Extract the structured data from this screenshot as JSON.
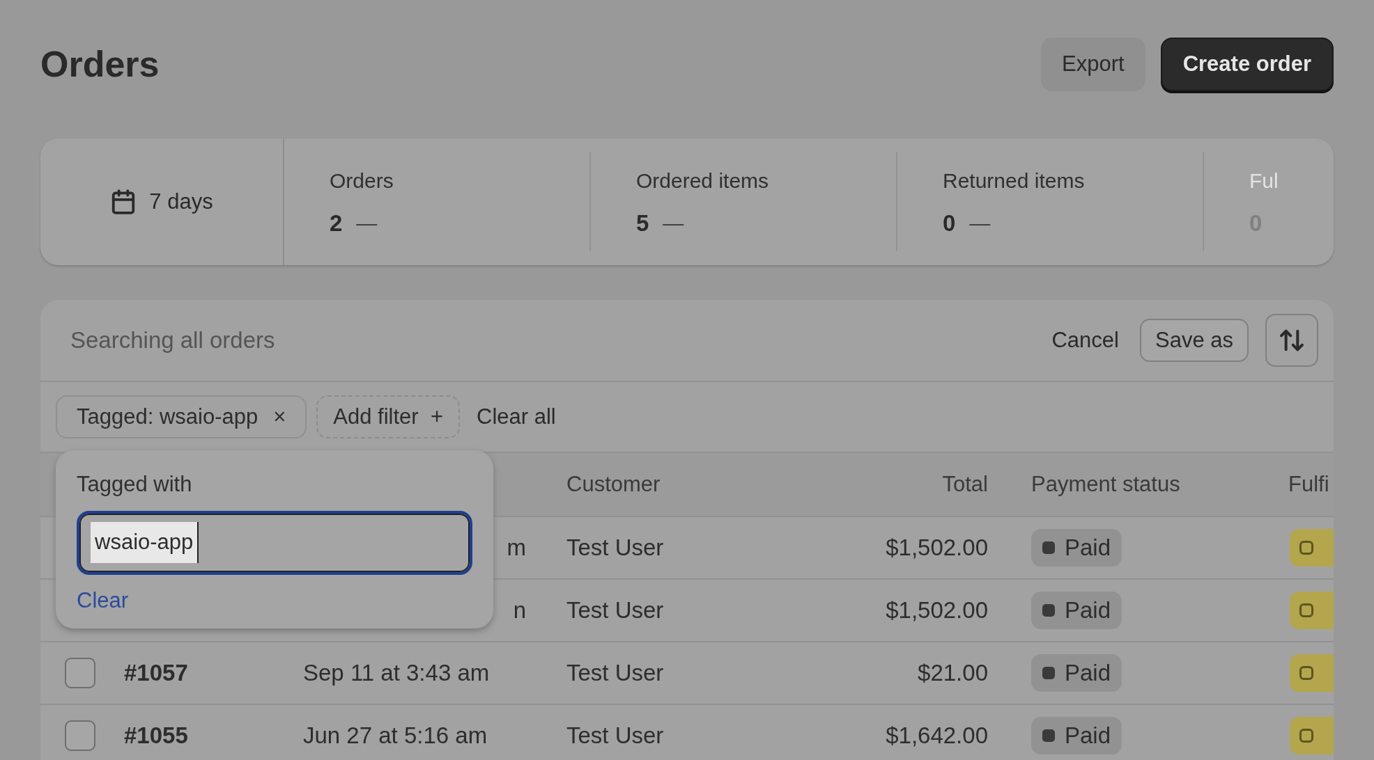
{
  "page": {
    "title": "Orders",
    "actions": [
      {
        "label": "Export",
        "kind": "secondary"
      },
      {
        "label": "Create order",
        "kind": "primary"
      }
    ]
  },
  "stats": {
    "date_range": "7 days",
    "metrics": [
      {
        "label": "Orders",
        "value": "2",
        "trend": "—",
        "faded": false
      },
      {
        "label": "Ordered items",
        "value": "5",
        "trend": "—",
        "faded": false
      },
      {
        "label": "Returned items",
        "value": "0",
        "trend": "—",
        "faded": false
      },
      {
        "label": "Ful",
        "value": "0",
        "faded": true
      }
    ]
  },
  "search": {
    "label": "Searching all orders",
    "actions": [
      {
        "label": "Cancel",
        "kind": "plain"
      },
      {
        "label": "Save as",
        "kind": "outlined"
      }
    ]
  },
  "filters": {
    "chips": [
      {
        "label": "Tagged: wsaio-app",
        "remove_glyph": "×"
      }
    ],
    "add_filter": "Add filter",
    "add_glyph": "+",
    "clear_all": "Clear all"
  },
  "popover": {
    "title": "Tagged with",
    "value": "wsaio-app",
    "text_selected": true,
    "clear": "Clear"
  },
  "table": {
    "columns": [
      "Customer",
      "Total",
      "Payment status",
      "Fulfi"
    ],
    "rows": [
      {
        "kind": "partial",
        "date": "m",
        "customer": "Test User",
        "total": "$1,502.00",
        "payment": "Paid"
      },
      {
        "kind": "partial",
        "date": "n",
        "customer": "Test User",
        "total": "$1,502.00",
        "payment": "Paid"
      },
      {
        "kind": "full",
        "checked": false,
        "order": "#1057",
        "date": "Sep 11 at 3:43 am",
        "customer": "Test User",
        "total": "$21.00",
        "payment": "Paid"
      },
      {
        "kind": "full",
        "checked": false,
        "order": "#1055",
        "date": "Jun 27 at 5:16 am",
        "customer": "Test User",
        "total": "$1,642.00",
        "payment": "Paid"
      }
    ]
  }
}
